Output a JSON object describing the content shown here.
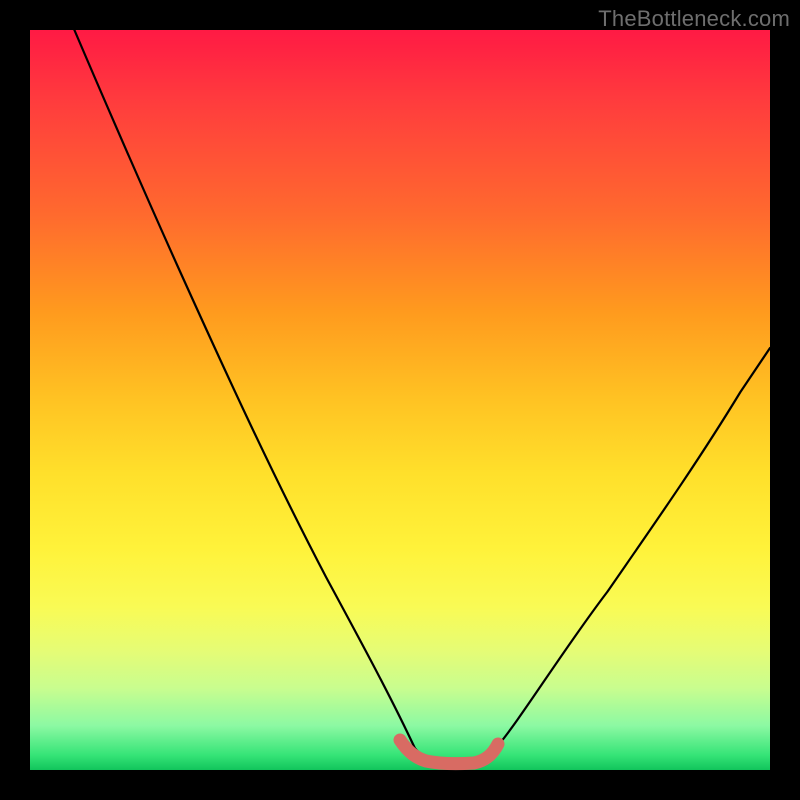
{
  "watermark": "TheBottleneck.com",
  "chart_data": {
    "type": "line",
    "title": "",
    "xlabel": "",
    "ylabel": "",
    "xlim": [
      0,
      100
    ],
    "ylim": [
      0,
      100
    ],
    "grid": false,
    "legend": false,
    "note": "Values estimated from pixel positions; no axis labels present.",
    "series": [
      {
        "name": "left-branch",
        "x": [
          6,
          10,
          15,
          20,
          25,
          30,
          35,
          40,
          45,
          48,
          50,
          52
        ],
        "y": [
          100,
          90,
          79,
          68,
          57,
          46,
          36,
          26,
          15,
          8,
          4,
          3
        ]
      },
      {
        "name": "valley-floor",
        "x": [
          52,
          54,
          56,
          58,
          60,
          62
        ],
        "y": [
          3,
          2.6,
          2.5,
          2.5,
          2.7,
          3.2
        ]
      },
      {
        "name": "right-branch",
        "x": [
          62,
          66,
          72,
          78,
          84,
          90,
          96,
          100
        ],
        "y": [
          3.2,
          7,
          15,
          24,
          33,
          42,
          51,
          57
        ]
      }
    ],
    "highlight": {
      "name": "valley-highlight",
      "color": "#d86b63",
      "x": [
        50,
        52,
        54,
        56,
        58,
        60,
        62,
        63
      ],
      "y": [
        4.0,
        3.0,
        2.6,
        2.5,
        2.5,
        2.7,
        3.2,
        4.0
      ]
    },
    "background_gradient": {
      "top": "#ff1a44",
      "bottom": "#11c45b"
    }
  }
}
